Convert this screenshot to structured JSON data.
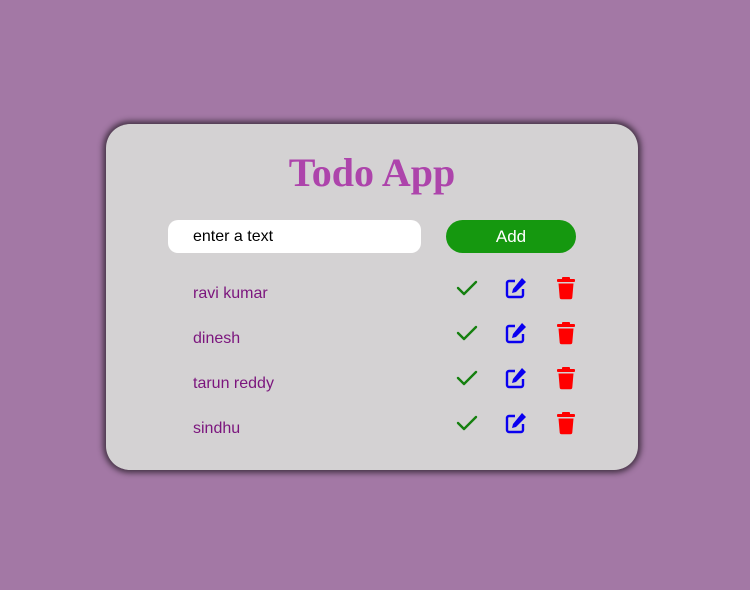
{
  "app": {
    "title": "Todo App"
  },
  "form": {
    "input_value": "enter a text",
    "add_label": "Add"
  },
  "todos": [
    {
      "text": "ravi kumar"
    },
    {
      "text": "dinesh"
    },
    {
      "text": "tarun reddy"
    },
    {
      "text": "sindhu"
    }
  ],
  "icons": {
    "complete": "check-icon",
    "edit": "edit-icon",
    "delete": "trash-icon"
  },
  "colors": {
    "background": "#a378a5",
    "card": "#d4d2d3",
    "title": "#ad44ab",
    "add_button": "#15980f",
    "todo_text": "#7b157d",
    "check": "#15800f",
    "edit": "#0a00f0",
    "delete": "#ff0000"
  }
}
